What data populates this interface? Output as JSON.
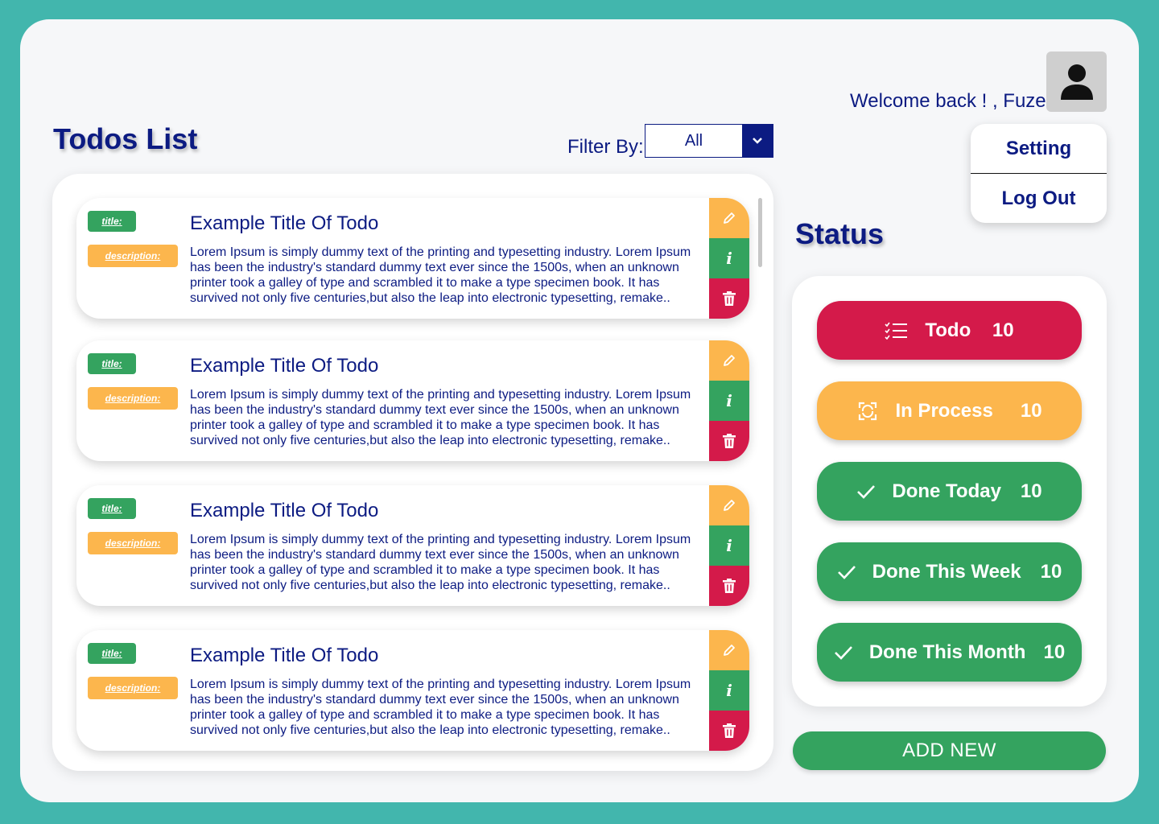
{
  "header": {
    "welcome": "Welcome back ! , Fuze",
    "menu": {
      "setting": "Setting",
      "logout": "Log Out"
    }
  },
  "todos": {
    "title": "Todos List",
    "filter_label": "Filter By:",
    "filter_value": "All",
    "tag_title": "title:",
    "tag_description": "description:",
    "items": [
      {
        "title": "Example Title Of Todo",
        "description": "Lorem Ipsum is simply dummy text of the printing and typesetting industry. Lorem Ipsum has been the industry's standard dummy text ever since the 1500s, when an unknown printer took a galley of type and scrambled it to make a type specimen book. It has survived not only five centuries,but also the leap into electronic typesetting, remake.."
      },
      {
        "title": "Example Title Of Todo",
        "description": "Lorem Ipsum is simply dummy text of the printing and typesetting industry. Lorem Ipsum has been the industry's standard dummy text ever since the 1500s, when an unknown printer took a galley of type and scrambled it to make a type specimen book. It has survived not only five centuries,but also the leap into electronic typesetting, remake.."
      },
      {
        "title": "Example Title Of Todo",
        "description": "Lorem Ipsum is simply dummy text of the printing and typesetting industry. Lorem Ipsum has been the industry's standard dummy text ever since the 1500s, when an unknown printer took a galley of type and scrambled it to make a type specimen book. It has survived not only five centuries,but also the leap into electronic typesetting, remake.."
      },
      {
        "title": "Example Title Of Todo",
        "description": "Lorem Ipsum is simply dummy text of the printing and typesetting industry. Lorem Ipsum has been the industry's standard dummy text ever since the 1500s, when an unknown printer took a galley of type and scrambled it to make a type specimen book. It has survived not only five centuries,but also the leap into electronic typesetting, remake.."
      }
    ],
    "info_glyph": "i"
  },
  "status": {
    "title": "Status",
    "items": [
      {
        "label": "Todo",
        "count": "10",
        "icon": "checklist-icon",
        "color": "#d41a4a"
      },
      {
        "label": "In Process",
        "count": "10",
        "icon": "refresh-icon",
        "color": "#fcb64d"
      },
      {
        "label": "Done Today",
        "count": "10",
        "icon": "check-icon",
        "color": "#34a35f"
      },
      {
        "label": "Done This Week",
        "count": "10",
        "icon": "check-icon",
        "color": "#34a35f"
      },
      {
        "label": "Done This Month",
        "count": "10",
        "icon": "check-icon",
        "color": "#34a35f"
      }
    ],
    "add_new": "ADD NEW"
  },
  "colors": {
    "background": "#42b6ad",
    "navy": "#0c1b82",
    "red": "#d41a4a",
    "orange": "#fcb64d",
    "green": "#34a35f"
  }
}
